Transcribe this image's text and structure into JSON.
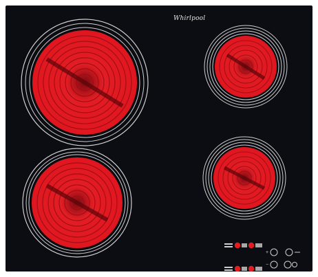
{
  "brand": {
    "name": "Whirlpool"
  },
  "colors": {
    "surface": "#0c0d12",
    "hot": "#e31b22",
    "coil": "#8a0a12",
    "ring": "#c9c9c9",
    "control": "#e31b22"
  },
  "zones": [
    {
      "id": "front-left-large",
      "rings": 2
    },
    {
      "id": "back-right-small",
      "rings": 3
    },
    {
      "id": "front-left-medium",
      "rings": 2
    },
    {
      "id": "front-right-medium",
      "rings": 3
    }
  ],
  "controls": {
    "plus_symbol": "+",
    "minus_symbol": "−"
  }
}
